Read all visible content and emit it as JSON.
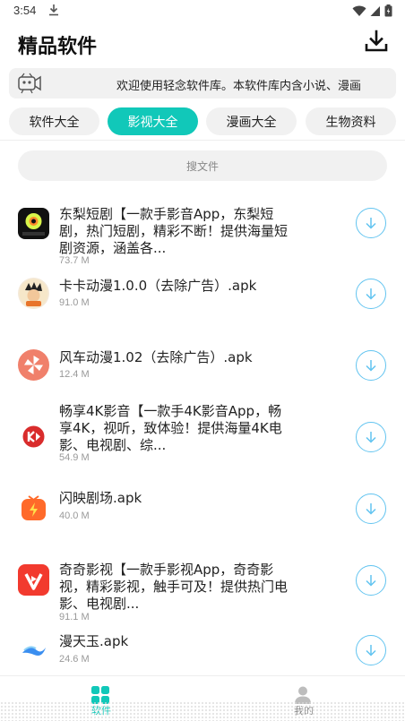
{
  "status_bar": {
    "time": "3:54"
  },
  "header": {
    "title": "精品软件"
  },
  "notice": {
    "text": "欢迎使用轻念软件库。本软件库内含小说、漫画"
  },
  "tabs": [
    {
      "label": "软件大全"
    },
    {
      "label": "影视大全",
      "active": true
    },
    {
      "label": "漫画大全"
    },
    {
      "label": "生物资料"
    }
  ],
  "search": {
    "placeholder": "搜文件"
  },
  "items": [
    {
      "name": "东梨短剧【一款手影音App，东梨短剧，热门短剧，精彩不断！提供海量短剧资源，涵盖各...",
      "size": "73.7 M",
      "icon": "dongli-icon"
    },
    {
      "name": "卡卡动漫1.0.0（去除广告）.apk",
      "size": "91.0 M",
      "icon": "kaka-icon"
    },
    {
      "name": "风车动漫1.02（去除广告）.apk",
      "size": "12.4 M",
      "icon": "fengche-icon"
    },
    {
      "name": "畅享4K影音【一款手4K影音App，畅享4K，视听，致体验！提供海量4K电影、电视剧、综...",
      "size": "54.9 M",
      "icon": "changxiang-icon"
    },
    {
      "name": "闪映剧场.apk",
      "size": "40.0 M",
      "icon": "shanying-icon"
    },
    {
      "name": "奇奇影视【一款手影视App，奇奇影视，精彩影视，触手可及！提供热门电影、电视剧...",
      "size": "91.1 M",
      "icon": "qiqi-icon"
    },
    {
      "name": "漫天玉.apk",
      "size": "24.6 M",
      "icon": "mantianyu-icon"
    }
  ],
  "bottom_nav": [
    {
      "label": "软件",
      "active": true
    },
    {
      "label": "我的"
    }
  ],
  "colors": {
    "accent": "#11c8b9",
    "download_ring": "#62c4f0"
  }
}
